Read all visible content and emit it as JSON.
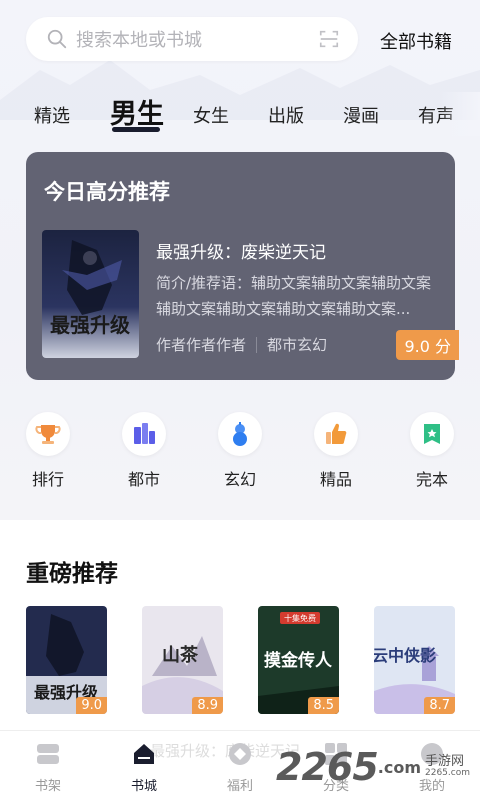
{
  "search": {
    "placeholder": "搜索本地或书城",
    "right_link": "全部书籍"
  },
  "tabs": [
    "精选",
    "男生",
    "女生",
    "出版",
    "漫画",
    "有声"
  ],
  "active_tab": "男生",
  "featured": {
    "heading": "今日高分推荐",
    "book_title": "最强升级：废柴逆天记",
    "intro": "简介/推荐语：辅助文案辅助文案辅助文案辅助文案辅助文案辅助文案辅助文案...",
    "author": "作者作者作者",
    "genre": "都市玄幻",
    "score": "9.0 分",
    "cover_art_text": "最强升级"
  },
  "categories": [
    {
      "label": "排行",
      "icon": "trophy-icon",
      "color": "#f08a3c"
    },
    {
      "label": "都市",
      "icon": "city-icon",
      "color": "#5b5ee8"
    },
    {
      "label": "玄幻",
      "icon": "gourd-icon",
      "color": "#2f7ef0"
    },
    {
      "label": "精品",
      "icon": "thumbs-up-icon",
      "color": "#f29a3a"
    },
    {
      "label": "完本",
      "icon": "book-complete-icon",
      "color": "#2fbf86"
    }
  ],
  "recommend": {
    "heading": "重磅推荐",
    "books": [
      {
        "rating": "9.0",
        "cover_text": "最强升级"
      },
      {
        "rating": "8.9",
        "cover_text": "山茶"
      },
      {
        "rating": "8.5",
        "cover_text": "摸金传人",
        "tag": "十集免费"
      },
      {
        "rating": "8.7",
        "cover_text": "云中侠影"
      }
    ]
  },
  "nav": [
    {
      "label": "书架",
      "icon": "bookshelf-icon"
    },
    {
      "label": "书城",
      "icon": "bookstore-icon"
    },
    {
      "label": "福利",
      "icon": "welfare-icon"
    },
    {
      "label": "分类",
      "icon": "category-icon"
    },
    {
      "label": "我的",
      "icon": "profile-icon"
    }
  ],
  "active_nav": "书城",
  "ghost_text": "最强升级：废柴逆天记",
  "watermark": {
    "number": "2265",
    "suffix": ".com",
    "cn": "手游网",
    "url": "2265.com"
  },
  "colors": {
    "accent": "#ef9a4a",
    "dark": "#1a1d2e",
    "card": "#626373"
  }
}
